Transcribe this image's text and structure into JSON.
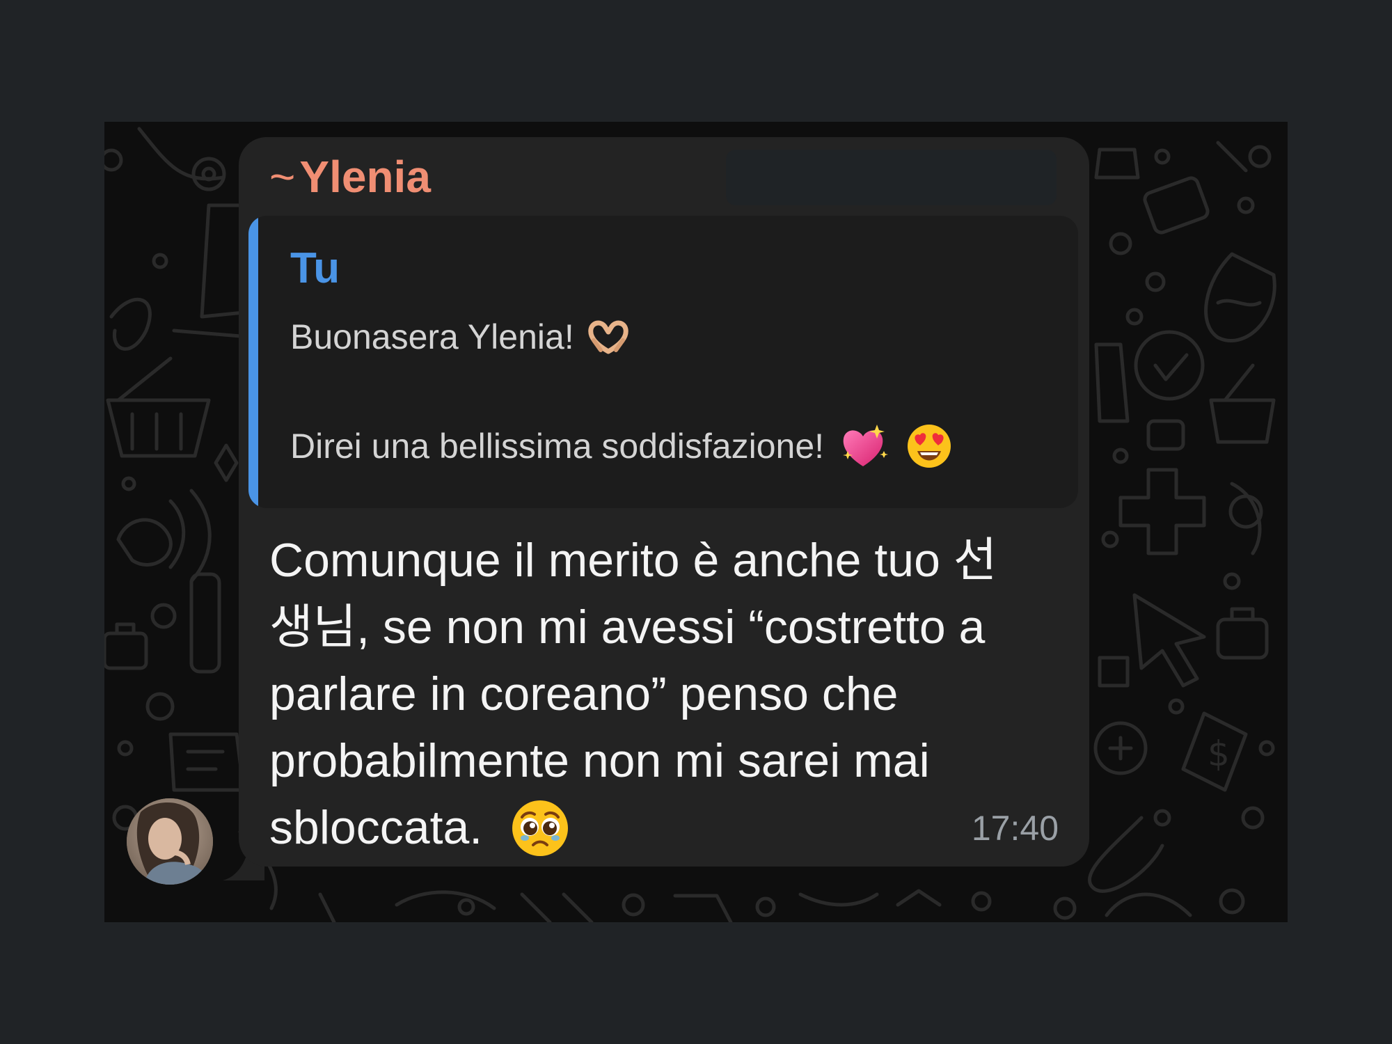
{
  "chat": {
    "sender_prefix": "~",
    "sender_name": "Ylenia",
    "sender_color": "#f08e73",
    "reply_quote": {
      "author": "Tu",
      "author_color": "#4a94e6",
      "line1": "Buonasera Ylenia!",
      "line1_emoji": "heart-hands-emoji",
      "line2": "Direi una bellissima soddisfazione!",
      "line2_emojis": [
        "sparkling-heart-emoji",
        "heart-eyes-emoji"
      ]
    },
    "message_lines": [
      "Comunque il merito è anche tuo 선",
      "생님, se non mi avessi “costretto a",
      "parlare in coreano” penso che",
      "probabilmente non mi sarei mai",
      "sbloccata."
    ],
    "message_emoji": "pleading-face-emoji",
    "timestamp": "17:40",
    "avatar": "user-avatar"
  }
}
